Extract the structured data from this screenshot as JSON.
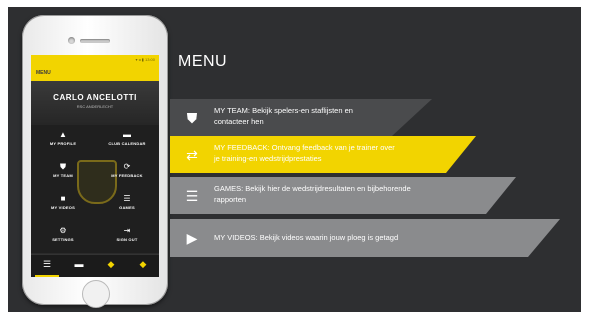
{
  "phone": {
    "status_text": "▾ ◂ ▮ 13:00",
    "app_bar_title": "MENU",
    "profile_name": "CARLO ANCELOTTI",
    "profile_subtitle": "RSC ANDERLECHT",
    "tiles": [
      {
        "icon": "person-icon",
        "glyph": "▲",
        "label": "MY PROFILE"
      },
      {
        "icon": "calendar-icon",
        "glyph": "▬",
        "label": "CLUB CALENDAR"
      },
      {
        "icon": "shield-icon",
        "glyph": "⛊",
        "label": "MY TEAM"
      },
      {
        "icon": "feedback-icon",
        "glyph": "⟳",
        "label": "MY FEEDBACK"
      },
      {
        "icon": "video-icon",
        "glyph": "■",
        "label": "MY VIDEOS"
      },
      {
        "icon": "list-icon",
        "glyph": "☰",
        "label": "GAMES"
      },
      {
        "icon": "gear-icon",
        "glyph": "⚙",
        "label": "SETTINGS"
      },
      {
        "icon": "signout-icon",
        "glyph": "⇥",
        "label": "SIGN OUT"
      }
    ],
    "tabbar": [
      "☰",
      "▬",
      "◆",
      "◆"
    ]
  },
  "menu": {
    "title": "MENU",
    "items": [
      {
        "icon": "shield-icon",
        "glyph": "⛊",
        "line1": "MY TEAM: Bekijk spelers-en staflijsten en",
        "line2": "contacteer hen"
      },
      {
        "icon": "feedback-icon",
        "glyph": "⇄",
        "line1": "MY FEEDBACK: Ontvang feedback van je trainer over",
        "line2": "je training-en wedstrijdprestaties"
      },
      {
        "icon": "list-icon",
        "glyph": "☰",
        "line1": "GAMES: Bekijk hier de wedstrijdresultaten  en bijbehorende",
        "line2": "rapporten"
      },
      {
        "icon": "video-camera-icon",
        "glyph": "▶",
        "line1": "MY VIDEOS: Bekijk videos waarin jouw ploeg is getagd",
        "line2": ""
      }
    ]
  },
  "colors": {
    "background": "#2e2f31",
    "accent": "#f2d400",
    "band_gray": "#8a8b8d",
    "band_dark": "#4a4b4d"
  }
}
